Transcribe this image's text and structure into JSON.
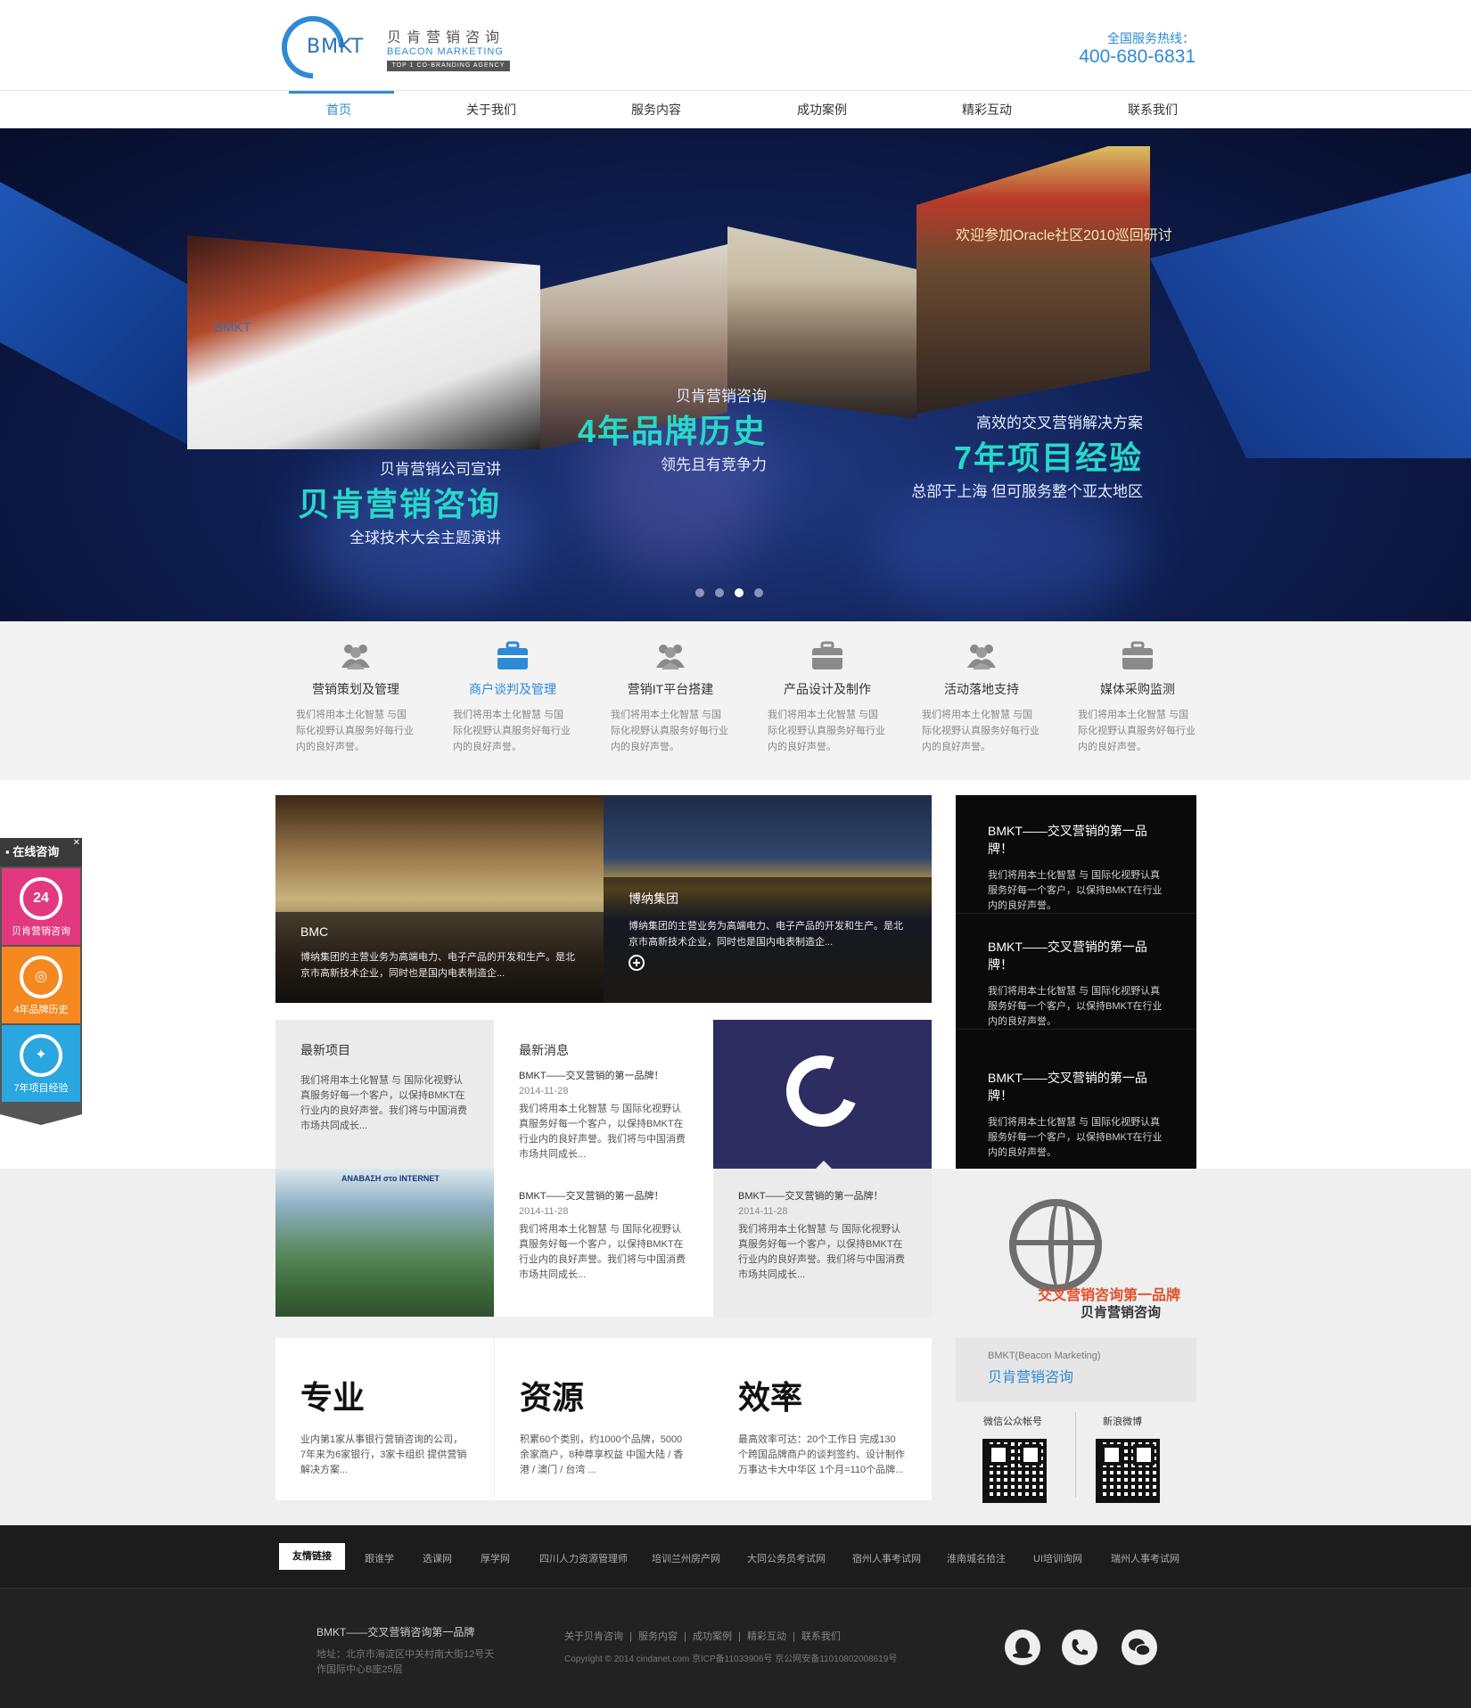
{
  "header": {
    "logo": {
      "mark_text": "BMKT",
      "cn_name": "贝肯营销咨询",
      "en_name": "BEACON MARKETING",
      "tagline": "TOP 1 CO-BRANDING AGENCY"
    },
    "hotline_label": "全国服务热线：",
    "hotline_number": "400-680-6831"
  },
  "nav": {
    "items": [
      "首页",
      "关于我们",
      "服务内容",
      "成功案例",
      "精彩互动",
      "联系我们"
    ],
    "active_index": 0
  },
  "banner": {
    "photo_sign": "欢迎参加Oracle社区2010巡回研讨",
    "captions": [
      {
        "small": "贝肯营销公司宣讲",
        "big": "贝肯营销咨询",
        "sub": "全球技术大会主题演讲"
      },
      {
        "small": "贝肯营销咨询",
        "big": "4年品牌历史",
        "sub": "领先且有竞争力"
      },
      {
        "small": "高效的交叉营销解决方案",
        "big": "7年项目经验",
        "sub": "总部于上海  但可服务整个亚太地区"
      }
    ],
    "slide_count": 4,
    "active_slide": 2
  },
  "services": [
    {
      "title": "营销策划及管理",
      "desc": "我们将用本土化智慧  与国际化视野认真服务好每行业内的良好声誉。",
      "icon": "people-icon"
    },
    {
      "title": "商户谈判及管理",
      "desc": "我们将用本土化智慧  与国际化视野认真服务好每行业内的良好声誉。",
      "icon": "briefcase-icon"
    },
    {
      "title": "营销IT平台搭建",
      "desc": "我们将用本土化智慧  与国际化视野认真服务好每行业内的良好声誉。",
      "icon": "people-icon"
    },
    {
      "title": "产品设计及制作",
      "desc": "我们将用本土化智慧  与国际化视野认真服务好每行业内的良好声誉。",
      "icon": "briefcase-icon"
    },
    {
      "title": "活动落地支持",
      "desc": "我们将用本土化智慧  与国际化视野认真服务好每行业内的良好声誉。",
      "icon": "people-icon"
    },
    {
      "title": "媒体采购监测",
      "desc": "我们将用本土化智慧  与国际化视野认真服务好每行业内的良好声誉。",
      "icon": "briefcase-icon"
    }
  ],
  "services_active_index": 1,
  "features": {
    "bmc": {
      "name": "BMC",
      "desc": "博纳集团的主营业务为高端电力、电子产品的开发和生产。是北京市高新技术企业，同时也是国内电表制造企..."
    },
    "bona": {
      "name": "博纳集团",
      "desc": "博纳集团的主营业务为高端电力、电子产品的开发和生产。是北京市高新技术企业，同时也是国内电表制造企..."
    }
  },
  "black_col": [
    {
      "title": "BMKT——交叉营销的第一品牌！",
      "desc": "我们将用本土化智慧  与 国际化视野认真服务好每一个客户，以保持BMKT在行业内的良好声誉。"
    },
    {
      "title": "BMKT——交叉营销的第一品牌！",
      "desc": "我们将用本土化智慧  与 国际化视野认真服务好每一个客户，以保持BMKT在行业内的良好声誉。"
    },
    {
      "title": "BMKT——交叉营销的第一品牌！",
      "desc": "我们将用本土化智慧  与 国际化视野认真服务好每一个客户，以保持BMKT在行业内的良好声誉。"
    }
  ],
  "latest_projects": {
    "title": "最新项目",
    "desc": "我们将用本土化智慧  与 国际化视野认真服务好每一个客户，以保持BMKT在行业内的良好声誉。我们将与中国消费市场共同成长..."
  },
  "latest_news": {
    "title": "最新消息",
    "items": [
      {
        "headline": "BMKT——交叉营销的第一品牌！",
        "date": "2014-11-28",
        "desc": "我们将用本土化智慧  与 国际化视野认真服务好每一个客户，以保持BMKT在行业内的良好声誉。我们将与中国消费市场共同成长..."
      },
      {
        "headline": "BMKT——交叉营销的第一品牌！",
        "date": "2014-11-28",
        "desc": "我们将用本土化智慧  与 国际化视野认真服务好每一个客户，以保持BMKT在行业内的良好声誉。我们将与中国消费市场共同成长..."
      },
      {
        "headline": "BMKT——交叉营销的第一品牌！",
        "date": "2014-11-28",
        "desc": "我们将用本土化智慧  与 国际化视野认真服务好每一个客户，以保持BMKT在行业内的良好声誉。我们将与中国消费市场共同成长..."
      }
    ]
  },
  "map_tile_title": "ANABAΣH στο INTERNET",
  "globe": {
    "tagline": "交叉营销咨询第一品牌",
    "brand": "贝肯营销咨询"
  },
  "brand_box": {
    "en": "BMKT(Beacon Marketing)",
    "cn": "贝肯营销咨询"
  },
  "qr": {
    "wechat_label": "微信公众帐号",
    "weibo_label": "新浪微博"
  },
  "stats": [
    {
      "word": "专业",
      "desc": "业内第1家从事银行营销咨询的公司，7年来为6家银行，3家卡组织 提供营销解决方案..."
    },
    {
      "word": "资源",
      "desc": "积累60个类别，约1000个品牌，5000余家商户，8种尊享权益 中国大陆 / 香港 / 澳门 / 台湾 ..."
    },
    {
      "word": "效率",
      "desc": "最高效率可达：20个工作日 完成130个跨国品牌商户的谈判签约、设计制作 万事达卡大中华区 1个月=110个品牌..."
    }
  ],
  "links": {
    "label": "友情链接",
    "items": [
      "跟谁学",
      "选课网",
      "厚学网",
      "四川人力资源管理师",
      "培训兰州房产网",
      "大同公务员考试网",
      "宿州人事考试网",
      "淮南城名拾注",
      "UI培训询网",
      "瑞州人事考试网"
    ]
  },
  "footer": {
    "title": "BMKT——交叉营销咨询第一品牌",
    "address": "地址：北京市海淀区中关村南大街12号天作国际中心B座25层",
    "nav": [
      "关于贝肯咨询",
      "服务内容",
      "成功案例",
      "精彩互动",
      "联系我们"
    ],
    "copyright": "Copyright © 2014 cindanet.com 京ICP备11033906号 京公网安备11010802008619号"
  },
  "side_float": {
    "header": "在线咨询",
    "items": [
      {
        "label": "贝肯营销咨询",
        "icon_text": "24",
        "color": "#e2387f"
      },
      {
        "label": "4年品牌历史",
        "icon_text": "◎",
        "color": "#f5881f"
      },
      {
        "label": "7年项目经验",
        "icon_text": "✦",
        "color": "#2aa6e0"
      }
    ]
  },
  "colors": {
    "accent": "#2f8ad6",
    "banner_cyan": "#28d8c8",
    "dark": "#0a0a0a",
    "globe_orange": "#e0502a"
  }
}
